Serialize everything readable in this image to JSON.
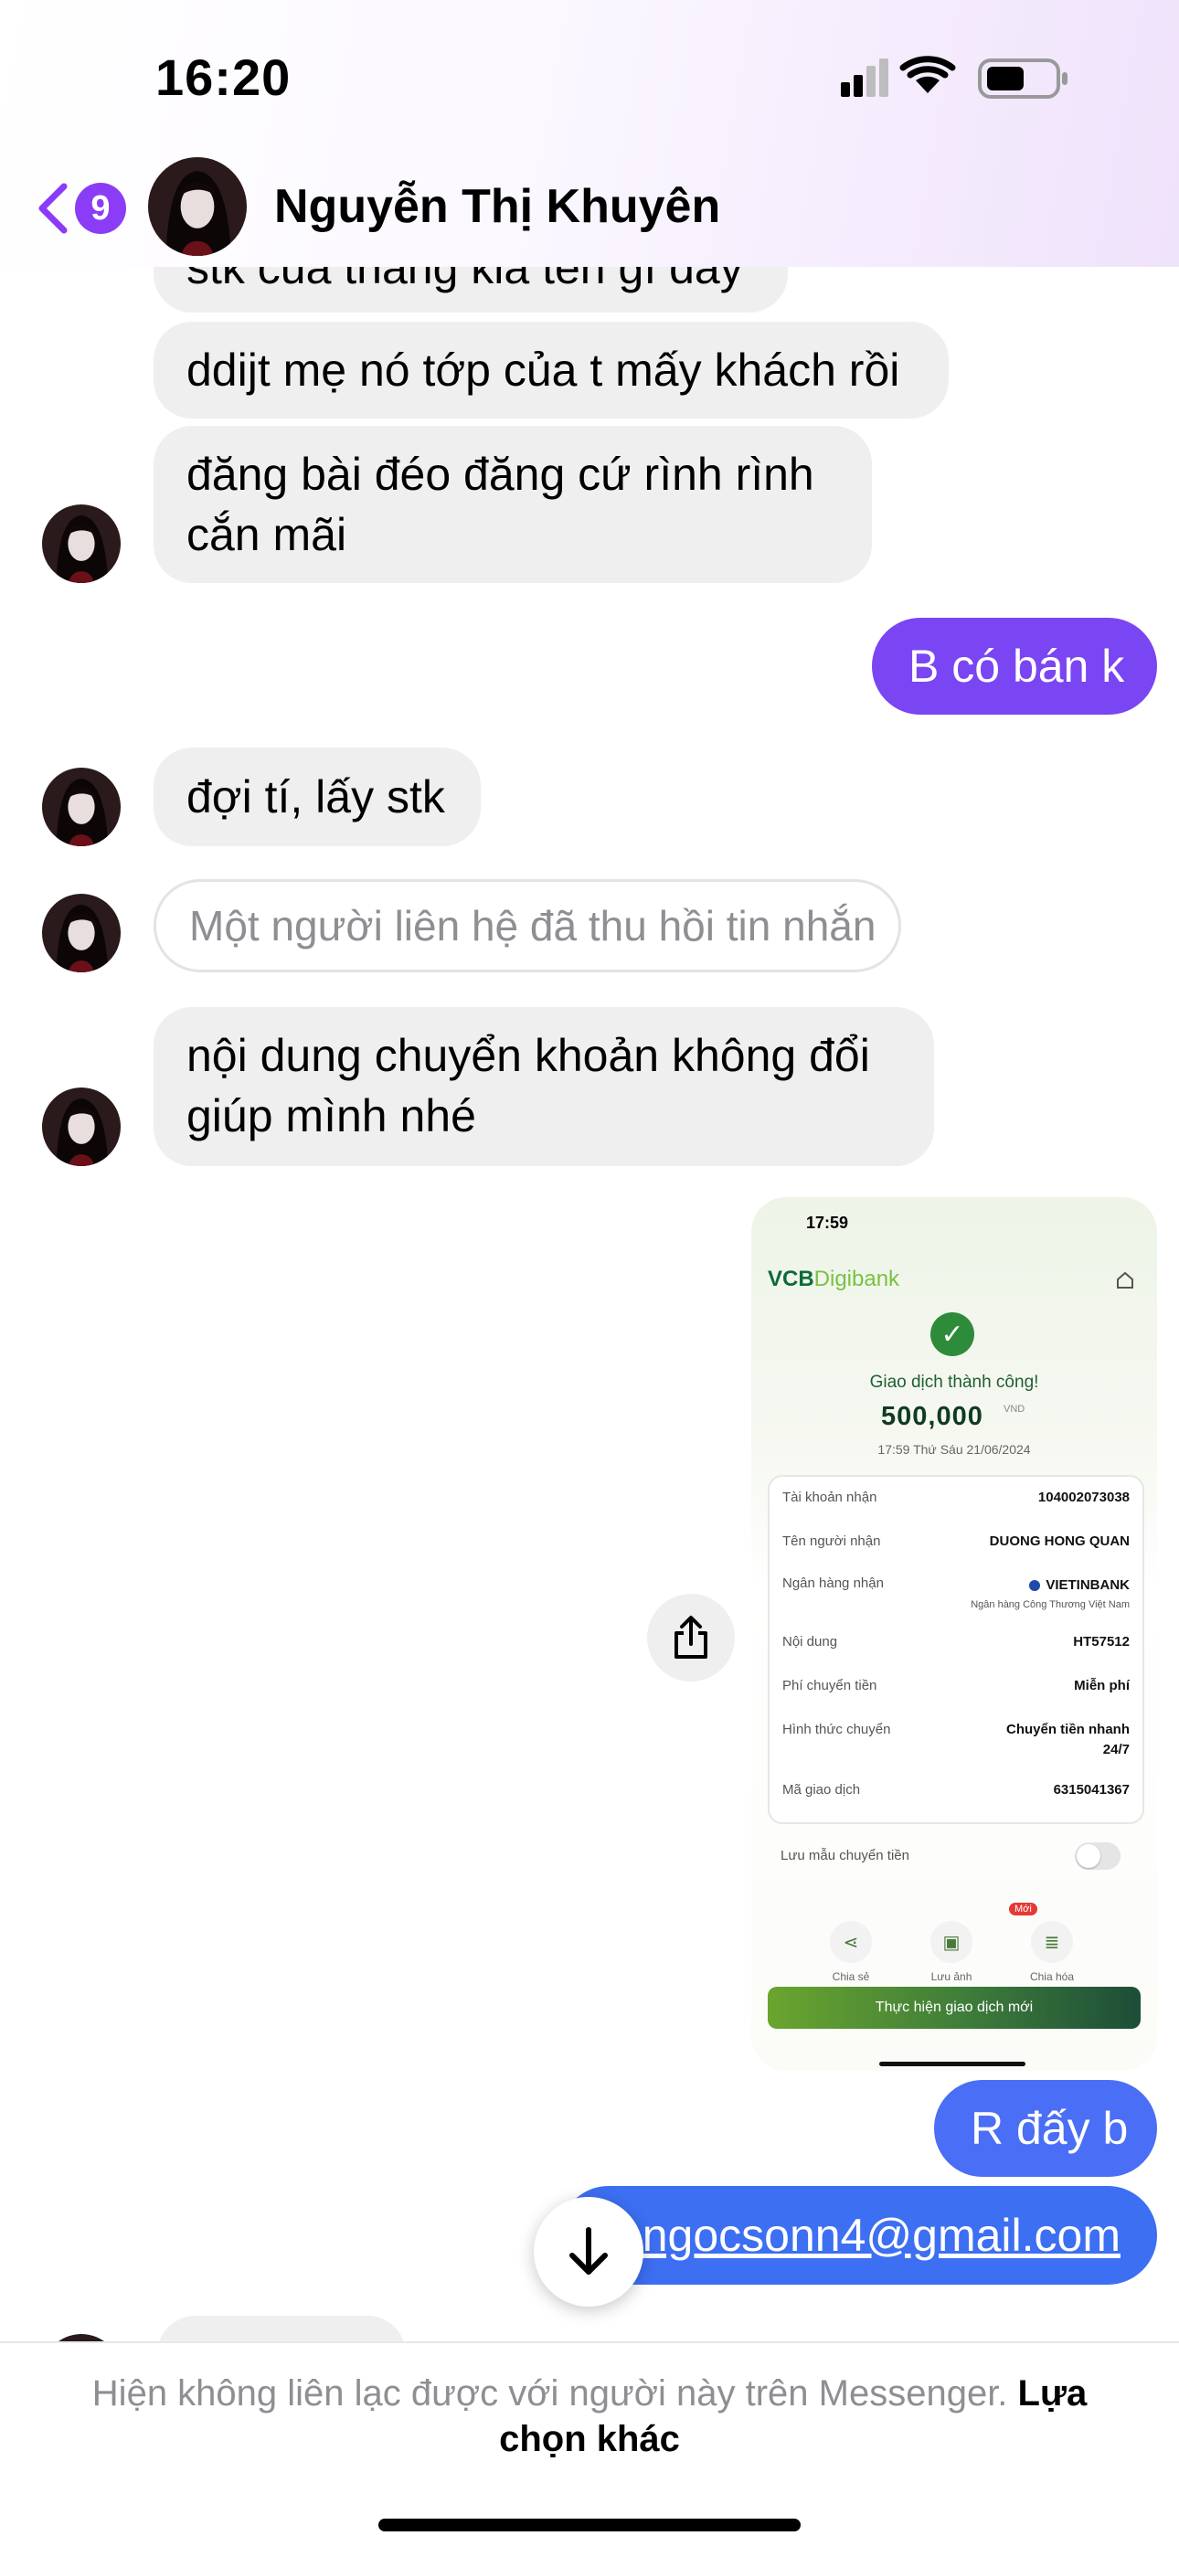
{
  "status_bar": {
    "time": "16:20"
  },
  "header": {
    "back_badge_count": "9",
    "contact_name": "Nguyễn Thị Khuyên",
    "icons": [
      "chevron-left-icon",
      "avatar"
    ]
  },
  "messages": [
    {
      "from": "contact",
      "text": "stk của thằng kia tên gì đấy"
    },
    {
      "from": "contact",
      "text": "ddijt mẹ nó tớp của t mấy khách rồi"
    },
    {
      "from": "contact",
      "line1": "đăng bài đéo đăng cứ rình rình",
      "line2": "cắn mãi"
    },
    {
      "from": "me",
      "text": "B có bán k"
    },
    {
      "from": "contact",
      "text": "đợi tí, lấy stk"
    },
    {
      "from": "contact",
      "text": "Một người liên hệ đã thu hồi tin nhắn",
      "recalled": true
    },
    {
      "from": "contact",
      "line1": "nội dung chuyển khoản không đổi",
      "line2": "giúp mình nhé"
    },
    {
      "from": "me",
      "text": "R đấy b"
    },
    {
      "from": "me",
      "text": "ngocsonn4@gmail.com",
      "is_link": true
    }
  ],
  "receipt": {
    "time": "17:59",
    "brand_a": "VCB",
    "brand_b": "Digibank",
    "status": "Giao dịch thành công!",
    "amount": "500,000",
    "currency": "VND",
    "datetime": "17:59 Thứ Sáu 21/06/2024",
    "rows": [
      {
        "label": "Tài khoản nhận",
        "value": "104002073038"
      },
      {
        "label": "Tên người nhận",
        "value": "DUONG HONG QUAN"
      },
      {
        "label": "Ngân hàng nhận",
        "value": "VIETINBANK",
        "sub": "Ngân hàng Công Thương Việt Nam"
      },
      {
        "label": "Nội dung",
        "value": "HT57512"
      },
      {
        "label": "Phí chuyển tiền",
        "value": "Miễn phí"
      },
      {
        "label": "Hình thức chuyển",
        "value": "Chuyển tiền nhanh",
        "value2": "24/7"
      },
      {
        "label": "Mã giao dịch",
        "value": "6315041367"
      }
    ],
    "save_template": "Lưu mẫu chuyển tiền",
    "actions": [
      "Chia sẻ",
      "Lưu ảnh",
      "Chia hóa"
    ],
    "new_badge": "Mới",
    "new_transaction": "Thực hiện giao dịch mới"
  },
  "footer": {
    "message": "Hiện không liên lạc được với người này trên Messenger.",
    "link": "Lựa chọn khác"
  },
  "colors": {
    "accent_purple": "#8b3cf7",
    "outgoing_purple": "#7a45f3",
    "outgoing_blue": "#3d6ff2",
    "incoming_gray": "#efefef"
  }
}
